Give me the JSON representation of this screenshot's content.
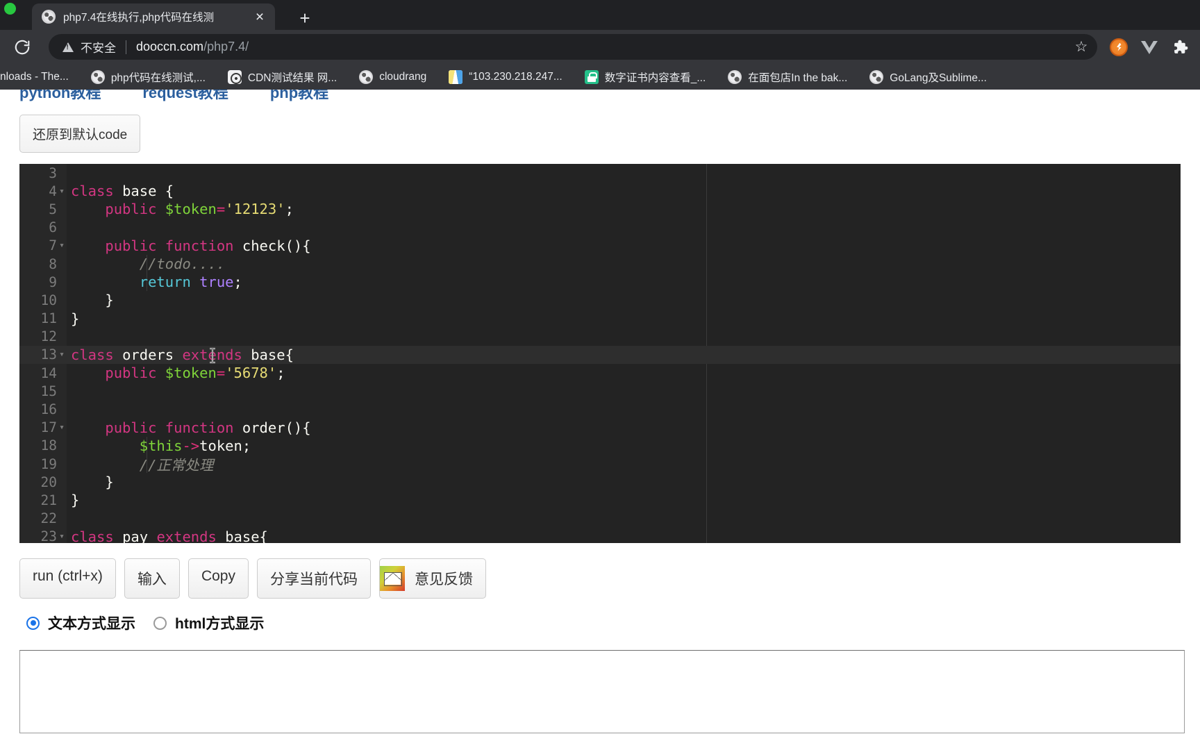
{
  "browser": {
    "tab": {
      "title": "php7.4在线执行,php代码在线测",
      "favicon": "globe-icon",
      "close_label": "×"
    },
    "new_tab_label": "+",
    "reload_label": "reload-icon",
    "omnibox": {
      "security_label": "不安全",
      "url_host": "dooccn.com",
      "url_path": "/php7.4/",
      "star_label": "☆"
    },
    "extensions": [
      {
        "name": "rocket-extension-icon",
        "label": ""
      },
      {
        "name": "vue-devtools-icon",
        "label": "V"
      },
      {
        "name": "extensions-puzzle-icon",
        "label": ""
      }
    ],
    "bookmarks": [
      {
        "label": "nloads - The...",
        "icon": "none"
      },
      {
        "label": "php代码在线测试,...",
        "icon": "globe"
      },
      {
        "label": "CDN测试结果 网...",
        "icon": "target"
      },
      {
        "label": "cloudrang",
        "icon": "globe"
      },
      {
        "label": "“103.230.218.247...",
        "icon": "bars"
      },
      {
        "label": "数字证书内容查看_...",
        "icon": "lock"
      },
      {
        "label": "在面包店In the bak...",
        "icon": "globe"
      },
      {
        "label": "GoLang及Sublime...",
        "icon": "globe"
      }
    ]
  },
  "page": {
    "topnav": [
      {
        "label": "python教程"
      },
      {
        "label": "request教程"
      },
      {
        "label": "php教程"
      }
    ],
    "restore_button": "还原到默认code",
    "editor": {
      "lines": [
        {
          "num": "3",
          "fold": "",
          "active": false,
          "tokens": []
        },
        {
          "num": "4",
          "fold": "▾",
          "active": false,
          "tokens": [
            {
              "t": "class ",
              "c": "tk-kw"
            },
            {
              "t": "base ",
              "c": "tk-pl"
            },
            {
              "t": "{",
              "c": "tk-pl"
            }
          ]
        },
        {
          "num": "5",
          "fold": "",
          "active": false,
          "tokens": [
            {
              "t": "    ",
              "c": "tk-pl"
            },
            {
              "t": "public ",
              "c": "tk-kw"
            },
            {
              "t": "$token",
              "c": "tk-var"
            },
            {
              "t": "=",
              "c": "tk-op"
            },
            {
              "t": "'12123'",
              "c": "tk-str"
            },
            {
              "t": ";",
              "c": "tk-pl"
            }
          ]
        },
        {
          "num": "6",
          "fold": "",
          "active": false,
          "tokens": []
        },
        {
          "num": "7",
          "fold": "▾",
          "active": false,
          "tokens": [
            {
              "t": "    ",
              "c": "tk-pl"
            },
            {
              "t": "public ",
              "c": "tk-kw"
            },
            {
              "t": "function ",
              "c": "tk-kw"
            },
            {
              "t": "check(){",
              "c": "tk-pl"
            }
          ]
        },
        {
          "num": "8",
          "fold": "",
          "active": false,
          "tokens": [
            {
              "t": "        ",
              "c": "tk-pl"
            },
            {
              "t": "//todo....",
              "c": "tk-com"
            }
          ]
        },
        {
          "num": "9",
          "fold": "",
          "active": false,
          "tokens": [
            {
              "t": "        ",
              "c": "tk-pl"
            },
            {
              "t": "return ",
              "c": "tk-ret"
            },
            {
              "t": "true",
              "c": "tk-bool"
            },
            {
              "t": ";",
              "c": "tk-pl"
            }
          ]
        },
        {
          "num": "10",
          "fold": "",
          "active": false,
          "tokens": [
            {
              "t": "    }",
              "c": "tk-pl"
            }
          ]
        },
        {
          "num": "11",
          "fold": "",
          "active": false,
          "tokens": [
            {
              "t": "}",
              "c": "tk-pl"
            }
          ]
        },
        {
          "num": "12",
          "fold": "",
          "active": false,
          "tokens": []
        },
        {
          "num": "13",
          "fold": "▾",
          "active": true,
          "tokens": [
            {
              "t": "class ",
              "c": "tk-kw"
            },
            {
              "t": "orders ",
              "c": "tk-pl"
            },
            {
              "t": "extends ",
              "c": "tk-kw"
            },
            {
              "t": "base{",
              "c": "tk-pl"
            }
          ]
        },
        {
          "num": "14",
          "fold": "",
          "active": false,
          "tokens": [
            {
              "t": "    ",
              "c": "tk-pl"
            },
            {
              "t": "public ",
              "c": "tk-kw"
            },
            {
              "t": "$token",
              "c": "tk-var"
            },
            {
              "t": "=",
              "c": "tk-op"
            },
            {
              "t": "'5678'",
              "c": "tk-str"
            },
            {
              "t": ";",
              "c": "tk-pl"
            }
          ]
        },
        {
          "num": "15",
          "fold": "",
          "active": false,
          "tokens": []
        },
        {
          "num": "16",
          "fold": "",
          "active": false,
          "tokens": []
        },
        {
          "num": "17",
          "fold": "▾",
          "active": false,
          "tokens": [
            {
              "t": "    ",
              "c": "tk-pl"
            },
            {
              "t": "public ",
              "c": "tk-kw"
            },
            {
              "t": "function ",
              "c": "tk-kw"
            },
            {
              "t": "order(){",
              "c": "tk-pl"
            }
          ]
        },
        {
          "num": "18",
          "fold": "",
          "active": false,
          "tokens": [
            {
              "t": "        ",
              "c": "tk-pl"
            },
            {
              "t": "$this",
              "c": "tk-var"
            },
            {
              "t": "->",
              "c": "tk-op"
            },
            {
              "t": "token;",
              "c": "tk-pl"
            }
          ]
        },
        {
          "num": "19",
          "fold": "",
          "active": false,
          "tokens": [
            {
              "t": "        ",
              "c": "tk-pl"
            },
            {
              "t": "//正常处理",
              "c": "tk-com"
            }
          ]
        },
        {
          "num": "20",
          "fold": "",
          "active": false,
          "tokens": [
            {
              "t": "    }",
              "c": "tk-pl"
            }
          ]
        },
        {
          "num": "21",
          "fold": "",
          "active": false,
          "tokens": [
            {
              "t": "}",
              "c": "tk-pl"
            }
          ]
        },
        {
          "num": "22",
          "fold": "",
          "active": false,
          "tokens": []
        },
        {
          "num": "23",
          "fold": "▾",
          "active": false,
          "tokens": [
            {
              "t": "class ",
              "c": "tk-kw"
            },
            {
              "t": "pay ",
              "c": "tk-pl"
            },
            {
              "t": "extends ",
              "c": "tk-kw"
            },
            {
              "t": "base{",
              "c": "tk-pl"
            }
          ]
        }
      ]
    },
    "actions": {
      "run": "run (ctrl+x)",
      "input": "输入",
      "copy": "Copy",
      "share": "分享当前代码",
      "feedback": "意见反馈"
    },
    "display_mode": {
      "selected": "text",
      "options": [
        {
          "id": "text",
          "label": "文本方式显示",
          "checked": true
        },
        {
          "id": "html",
          "label": "html方式显示",
          "checked": false
        }
      ]
    },
    "output_value": ""
  },
  "colors": {
    "chrome_dark": "#35363a",
    "omnibox_dark": "#202124",
    "editor_bg": "#232323",
    "editor_gutter": "#282828",
    "active_line": "#2e2e2e",
    "keyword": "#d33682",
    "variable": "#7fd43a",
    "string": "#e6db74",
    "comment": "#8a8a82",
    "boolean": "#ae81ff",
    "return": "#56c8d8",
    "link_blue": "#2b5f9e",
    "radio_accent": "#1a73e8"
  }
}
